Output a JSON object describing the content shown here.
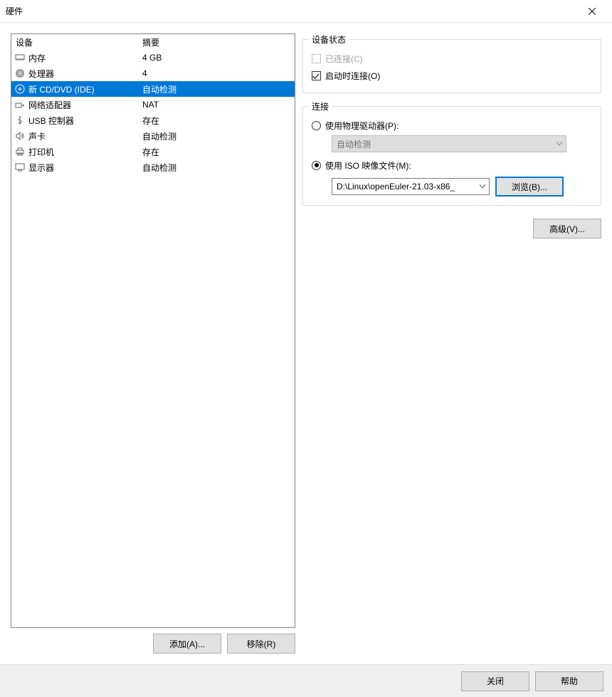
{
  "title": "硬件",
  "columns": {
    "device": "设备",
    "summary": "摘要"
  },
  "devices": [
    {
      "icon": "memory",
      "name": "内存",
      "summary": "4 GB",
      "selected": false
    },
    {
      "icon": "cpu",
      "name": "处理器",
      "summary": "4",
      "selected": false
    },
    {
      "icon": "cd",
      "name": "新 CD/DVD (IDE)",
      "summary": "自动检测",
      "selected": true
    },
    {
      "icon": "network",
      "name": "网络适配器",
      "summary": "NAT",
      "selected": false
    },
    {
      "icon": "usb",
      "name": "USB 控制器",
      "summary": "存在",
      "selected": false
    },
    {
      "icon": "sound",
      "name": "声卡",
      "summary": "自动检测",
      "selected": false
    },
    {
      "icon": "printer",
      "name": "打印机",
      "summary": "存在",
      "selected": false
    },
    {
      "icon": "display",
      "name": "显示器",
      "summary": "自动检测",
      "selected": false
    }
  ],
  "buttons": {
    "add": "添加(A)...",
    "remove": "移除(R)",
    "browse": "浏览(B)...",
    "advanced": "高级(V)...",
    "close": "关闭",
    "help": "帮助"
  },
  "groups": {
    "status": {
      "title": "设备状态",
      "connected": "已连接(C)",
      "connect_on_start": "启动时连接(O)"
    },
    "connection": {
      "title": "连接",
      "use_physical": "使用物理驱动器(P):",
      "physical_value": "自动检测",
      "use_iso": "使用 ISO 映像文件(M):",
      "iso_path": "D:\\Linux\\openEuler-21.03-x86_"
    }
  }
}
